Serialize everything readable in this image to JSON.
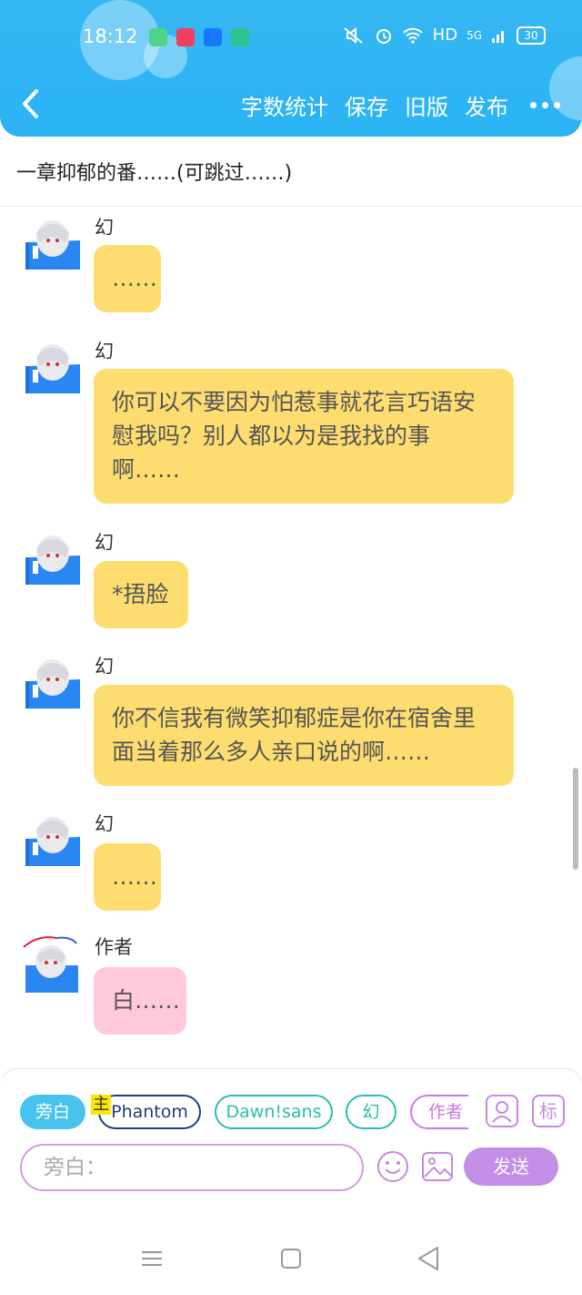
{
  "status_bar": {
    "time": "18:12",
    "network": "HD",
    "signal": "5G",
    "battery": "30"
  },
  "header": {
    "actions": [
      "字数统计",
      "保存",
      "旧版",
      "发布"
    ]
  },
  "chapter_title": "一章抑郁的番……(可跳过……)",
  "messages": [
    {
      "name": "幻",
      "text": "……",
      "style": "yellow"
    },
    {
      "name": "幻",
      "text": "你可以不要因为怕惹事就花言巧语安慰我吗？别人都以为是我找的事啊……",
      "style": "yellow"
    },
    {
      "name": "幻",
      "text": "*捂脸",
      "style": "yellow"
    },
    {
      "name": "幻",
      "text": "你不信我有微笑抑郁症是你在宿舍里面当着那么多人亲口说的啊……",
      "style": "yellow"
    },
    {
      "name": "幻",
      "text": "……",
      "style": "yellow"
    },
    {
      "name": "作者",
      "text": "白……",
      "style": "pink"
    }
  ],
  "roles": {
    "narration": "旁白",
    "main_badge": "主",
    "phantom": "Phantom",
    "dawn": "Dawn!sans",
    "huan": "幻",
    "author": "作者",
    "tag_icon": "标"
  },
  "input": {
    "placeholder": "旁白："
  },
  "send_label": "发送",
  "colors": {
    "header": "#2bb3f4",
    "bubble_yellow": "#fddd6f",
    "bubble_pink": "#ffc9d9",
    "send": "#c28ee6"
  }
}
